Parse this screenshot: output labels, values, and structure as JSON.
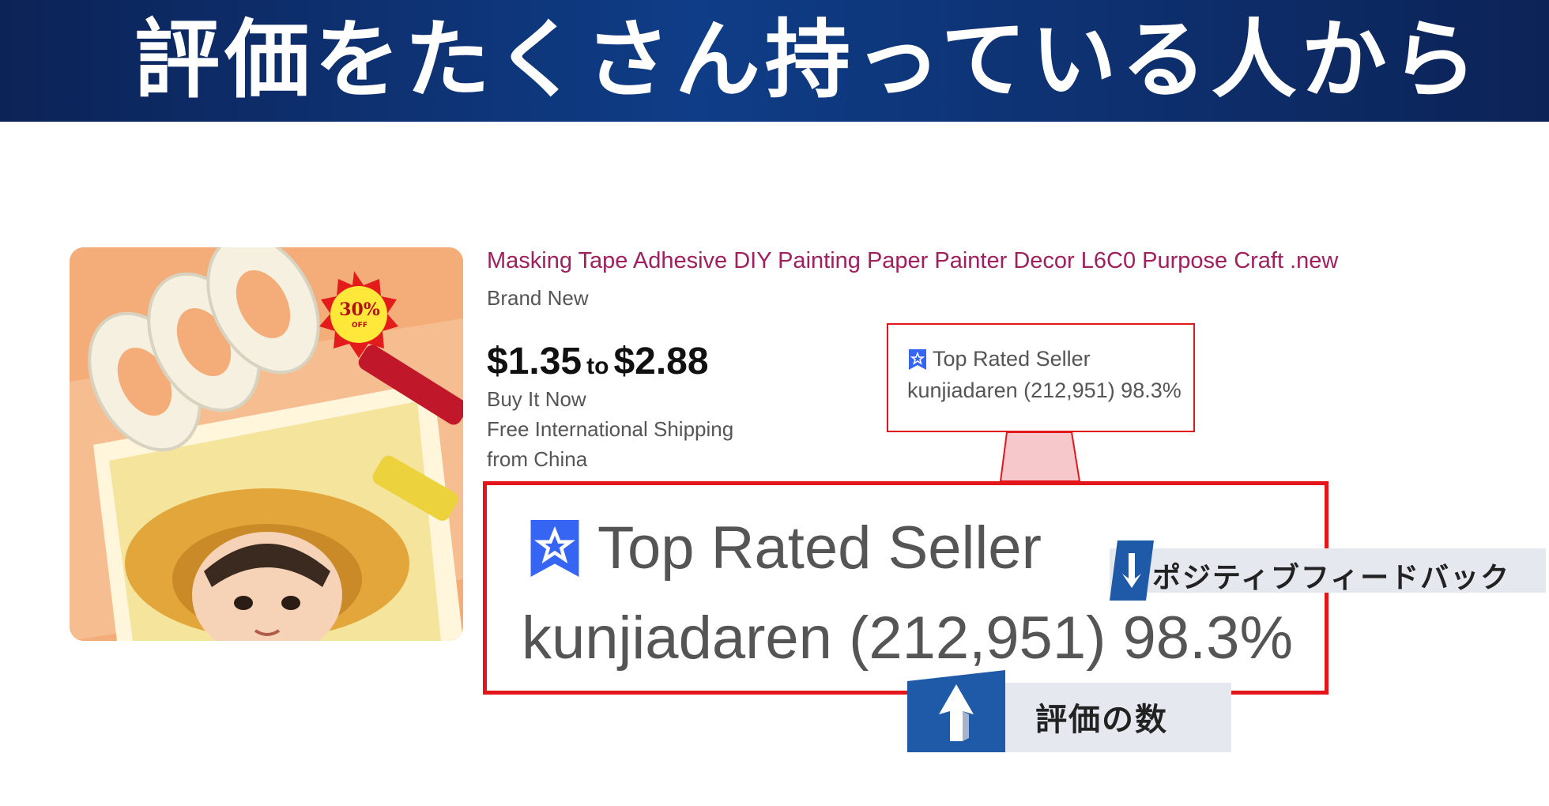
{
  "banner": {
    "title": "評価をたくさん持っている人から"
  },
  "listing": {
    "title": "Masking Tape Adhesive DIY Painting Paper Painter Decor L6C0 Purpose Craft .new",
    "condition": "Brand New",
    "price_low": "$1.35",
    "price_to": "to",
    "price_high": "$2.88",
    "buy_format": "Buy It Now",
    "shipping": "Free International Shipping",
    "location": "from China",
    "image": {
      "discount_sticker": "30%",
      "sticker_sub": "OFF"
    }
  },
  "seller": {
    "badge_label": "Top Rated Seller",
    "stats": "kunjiadaren (212,951) 98.3%"
  },
  "callouts": {
    "positive_feedback": "ポジティブフィードバック",
    "feedback_count": "評価の数"
  },
  "colors": {
    "banner": "#0f3d87",
    "title_link": "#a0205f",
    "highlight_border": "#e3161c",
    "badge_blue": "#3665f3",
    "callout_blue": "#1e5aa8"
  },
  "icons": [
    "top-rated-seller-badge-icon",
    "arrow-down-icon",
    "arrow-up-icon"
  ]
}
